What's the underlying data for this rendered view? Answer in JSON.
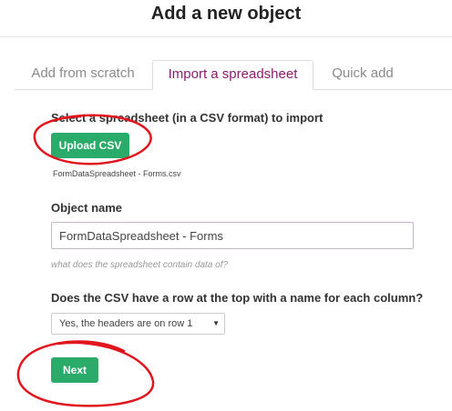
{
  "header": {
    "title": "Add a new object"
  },
  "tabs": [
    {
      "label": "Add from scratch",
      "active": false
    },
    {
      "label": "Import a spreadsheet",
      "active": true
    },
    {
      "label": "Quick add",
      "active": false
    }
  ],
  "import": {
    "select_label": "Select a spreadsheet (in a CSV format) to import",
    "upload_button": "Upload CSV",
    "filename": "FormDataSpreadsheet - Forms.csv",
    "object_name_label": "Object name",
    "object_name_value": "FormDataSpreadsheet - Forms",
    "object_name_hint": "what does the spreadsheet contain data of?",
    "headers_question": "Does the CSV have a row at the top with a name for each column?",
    "headers_select_value": "Yes, the headers are on row 1",
    "next_button": "Next"
  },
  "colors": {
    "accent_green": "#2bab6a",
    "active_tab": "#8b1c6e",
    "annotation_red": "#e0151d"
  }
}
